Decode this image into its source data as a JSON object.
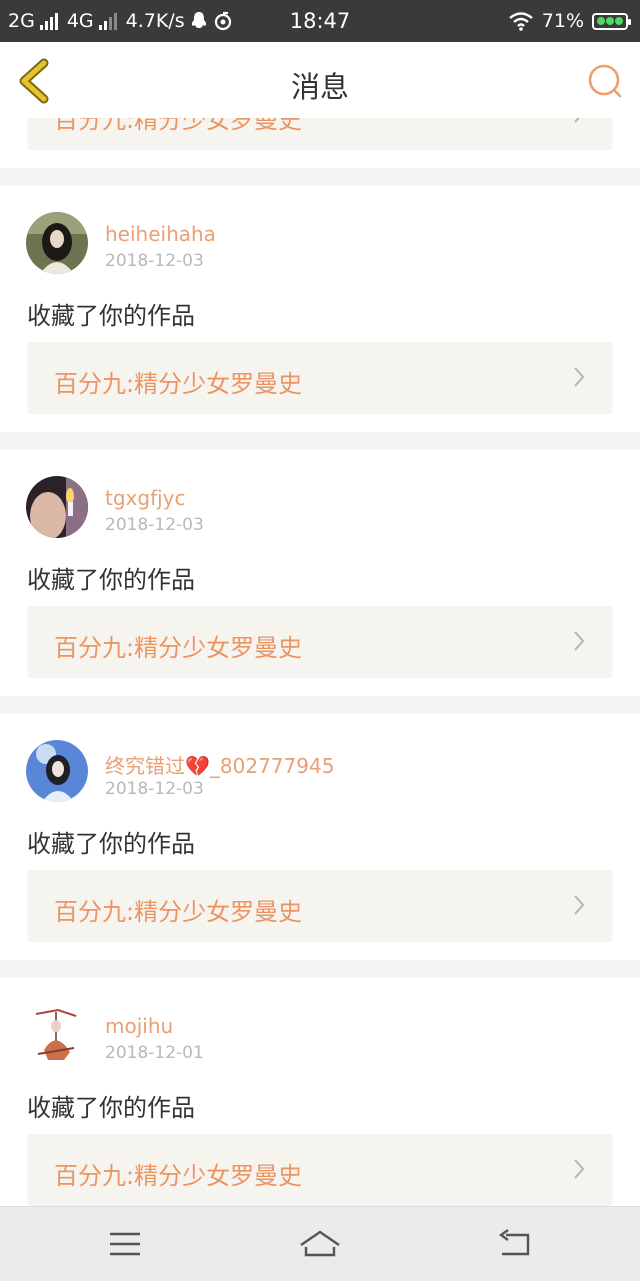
{
  "status_bar": {
    "net1": "2G",
    "net2": "4G",
    "speed": "4.7K/s",
    "time": "18:47",
    "battery": "71%"
  },
  "header": {
    "title": "消息"
  },
  "messages": [
    {
      "username": "",
      "date": "",
      "action": "",
      "work_title": "百分九:精分少女罗曼史"
    },
    {
      "username": "heiheihaha",
      "date": "2018-12-03",
      "action": "收藏了你的作品",
      "work_title": "百分九:精分少女罗曼史"
    },
    {
      "username": "tgxgfjyc",
      "date": "2018-12-03",
      "action": "收藏了你的作品",
      "work_title": "百分九:精分少女罗曼史"
    },
    {
      "username": "终究错过💔_802777945",
      "date": "2018-12-03",
      "action": "收藏了你的作品",
      "work_title": "百分九:精分少女罗曼史"
    },
    {
      "username": "mojihu",
      "date": "2018-12-01",
      "action": "收藏了你的作品",
      "work_title": "百分九:精分少女罗曼史"
    }
  ],
  "colors": {
    "accent": "#ec9563",
    "username": "#e8a074",
    "back_icon": "#c9a000",
    "card_bg": "#f6f4ef"
  }
}
